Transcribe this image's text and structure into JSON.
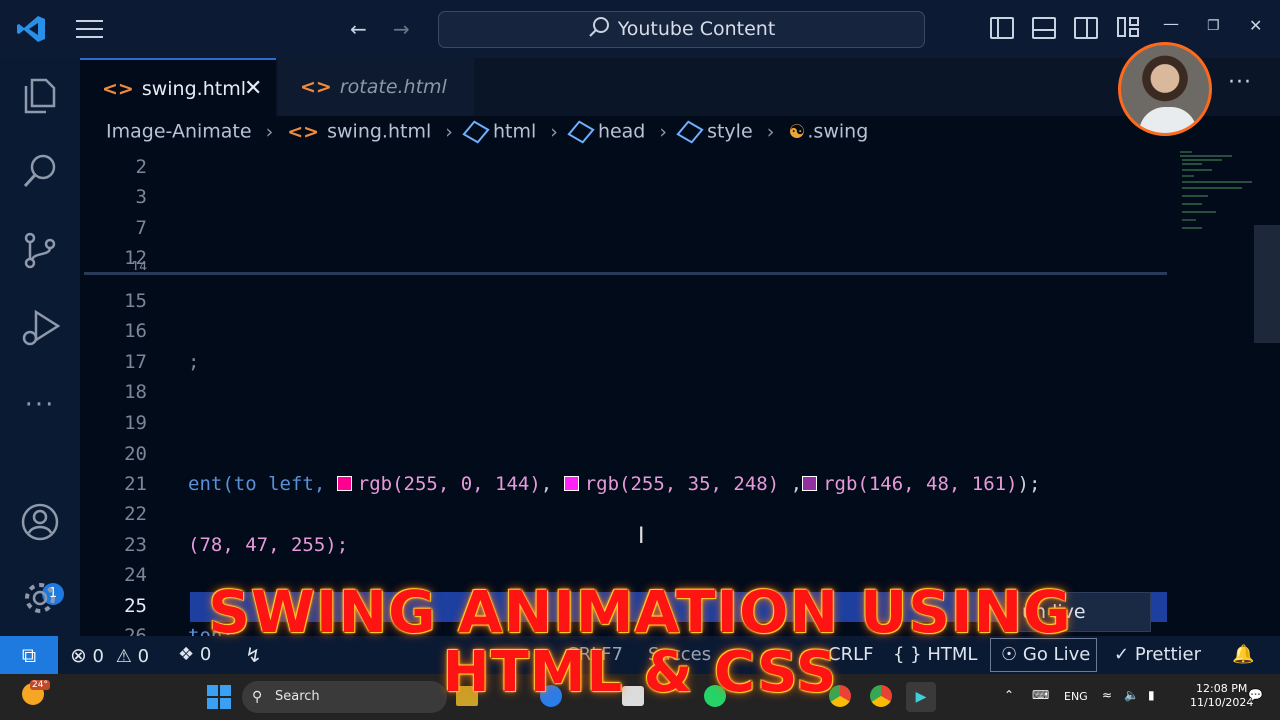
{
  "titlebar": {
    "search_text": "Youtube Content",
    "icons": [
      "vscode-logo-icon",
      "menu-icon",
      "back-arrow-icon",
      "forward-arrow-icon",
      "toggle-sidebar-icon",
      "toggle-panel-icon",
      "toggle-secondary-sidebar-icon",
      "customize-layout-icon",
      "minimize-icon",
      "restore-icon",
      "close-icon"
    ]
  },
  "tabs": [
    {
      "label": "swing.html",
      "active": true
    },
    {
      "label": "rotate.html",
      "active": false
    }
  ],
  "breadcrumb": {
    "folder": "Image-Animate",
    "file": "swing.html",
    "html": "html",
    "head": "head",
    "style": "style",
    "selector": ".swing"
  },
  "editor": {
    "line_numbers": [
      "2",
      "3",
      "7",
      "12",
      "14",
      "15",
      "16",
      "17",
      "18",
      "19",
      "20",
      "21",
      "22",
      "23",
      "24",
      "25",
      "26"
    ],
    "active_line": "25",
    "line17_fragment": ";",
    "line21": {
      "prefix": "ent(",
      "to": "to",
      "left": "left,",
      "colors": [
        {
          "text": "rgb(255, 0, 144)",
          "swatch": "#ff0090"
        },
        {
          "text": "rgb(255, 35, 248)",
          "swatch": "#ff23f8"
        },
        {
          "text": "rgb(146, 48, 161)",
          "swatch": "#9230a1"
        }
      ],
      "sep1": ",",
      "sep2": " ,",
      "end": ");"
    },
    "line23": "(78, 47, 255);",
    "line26_fragment": "ton:"
  },
  "toast": {
    "label": "un live server"
  },
  "status": {
    "errors": "0",
    "warnings": "0",
    "ports": "0",
    "line_ending": "CRLF",
    "language": "HTML",
    "go_live": "Go Live",
    "prettier": "Prettier",
    "partial1": "CRLF7",
    "partial2": "Succes"
  },
  "activity_bar": {
    "accounts_badge": "1"
  },
  "taskbar": {
    "temperature": "24°",
    "search_label": "Search",
    "language": "ENG",
    "time": "12:08 PM",
    "date": "11/10/2024"
  },
  "banner": {
    "line1": "SWING ANIMATION USING",
    "line2": "HTML & CSS"
  },
  "colors": {
    "accent": "#1f7ae0",
    "banner_fill": "#ff1414",
    "banner_glow": "#ffd84a"
  }
}
